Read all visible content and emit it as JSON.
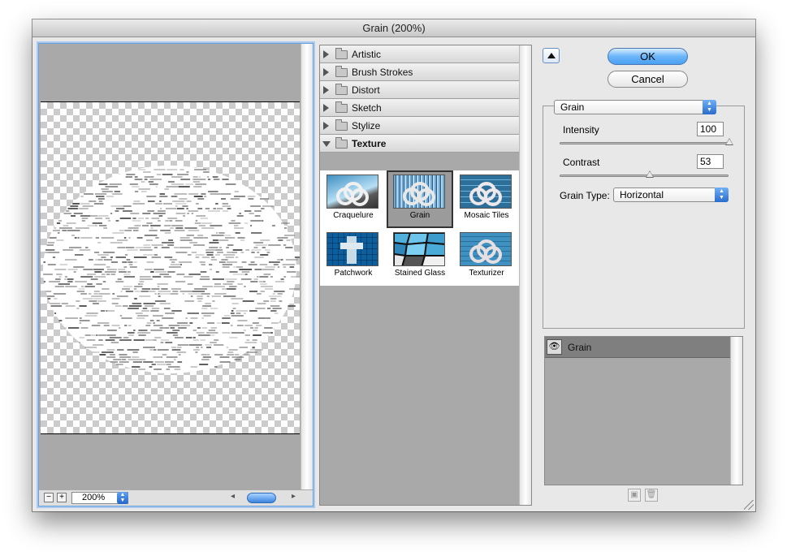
{
  "window": {
    "title": "Grain (200%)"
  },
  "preview": {
    "zoom_out_label": "−",
    "zoom_in_label": "+",
    "zoom_value": "200%",
    "scroll_left": "◂",
    "scroll_right": "▸"
  },
  "filter_categories": [
    {
      "label": "Artistic",
      "open": false
    },
    {
      "label": "Brush Strokes",
      "open": false
    },
    {
      "label": "Distort",
      "open": false
    },
    {
      "label": "Sketch",
      "open": false
    },
    {
      "label": "Stylize",
      "open": false
    },
    {
      "label": "Texture",
      "open": true
    }
  ],
  "texture_filters": [
    {
      "label": "Craquelure",
      "selected": false
    },
    {
      "label": "Grain",
      "selected": true
    },
    {
      "label": "Mosaic Tiles",
      "selected": false
    },
    {
      "label": "Patchwork",
      "selected": false
    },
    {
      "label": "Stained Glass",
      "selected": false
    },
    {
      "label": "Texturizer",
      "selected": false
    }
  ],
  "buttons": {
    "ok": "OK",
    "cancel": "Cancel"
  },
  "settings": {
    "filter_select": "Grain",
    "intensity_label": "Intensity",
    "intensity_value": "100",
    "intensity_fraction": 1.0,
    "contrast_label": "Contrast",
    "contrast_value": "53",
    "contrast_fraction": 0.53,
    "grain_type_label": "Grain Type:",
    "grain_type_value": "Horizontal"
  },
  "layers": {
    "items": [
      {
        "label": "Grain",
        "visible": true
      }
    ]
  },
  "icons": {
    "collapse": "triangle-up-icon",
    "eye": "eye-icon",
    "new_layer": "new-effect-layer-icon",
    "delete": "trash-icon",
    "folder": "folder-icon"
  }
}
